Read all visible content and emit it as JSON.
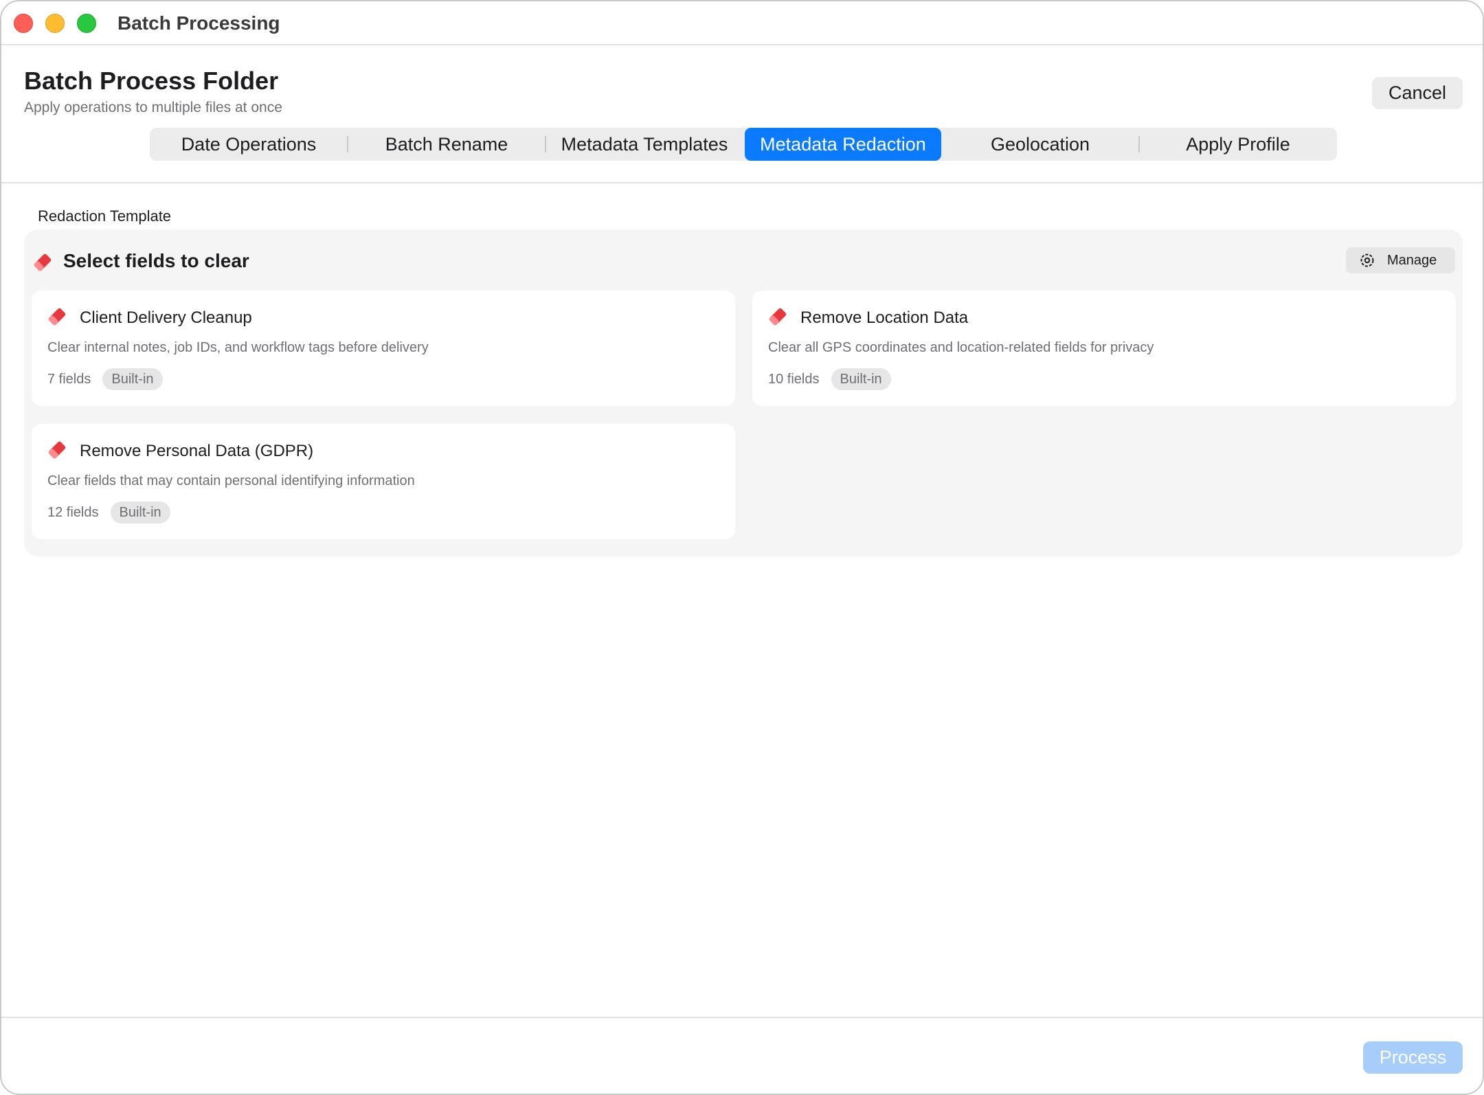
{
  "window": {
    "title": "Batch Processing"
  },
  "header": {
    "title": "Batch Process Folder",
    "subtitle": "Apply operations to multiple files at once",
    "cancel_label": "Cancel"
  },
  "tabs": [
    {
      "label": "Date Operations",
      "active": false
    },
    {
      "label": "Batch Rename",
      "active": false
    },
    {
      "label": "Metadata Templates",
      "active": false
    },
    {
      "label": "Metadata Redaction",
      "active": true
    },
    {
      "label": "Geolocation",
      "active": false
    },
    {
      "label": "Apply Profile",
      "active": false
    }
  ],
  "section": {
    "label": "Redaction Template",
    "title": "Select fields to clear",
    "title_icon": "eraser-icon",
    "manage_label": "Manage",
    "manage_icon": "gear-icon"
  },
  "templates": [
    {
      "title": "Client Delivery Cleanup",
      "description": "Clear internal notes, job IDs, and workflow tags before delivery",
      "count": "7 fields",
      "badge": "Built-in",
      "icon": "eraser-icon"
    },
    {
      "title": "Remove Location Data",
      "description": "Clear all GPS coordinates and location-related fields for privacy",
      "count": "10 fields",
      "badge": "Built-in",
      "icon": "eraser-icon"
    },
    {
      "title": "Remove Personal Data (GDPR)",
      "description": "Clear fields that may contain personal identifying information",
      "count": "12 fields",
      "badge": "Built-in",
      "icon": "eraser-icon"
    }
  ],
  "footer": {
    "process_label": "Process",
    "process_enabled": false
  },
  "colors": {
    "accent": "#0a7aff",
    "eraser": "#e8373d",
    "process_disabled": "#a7cdfa"
  }
}
